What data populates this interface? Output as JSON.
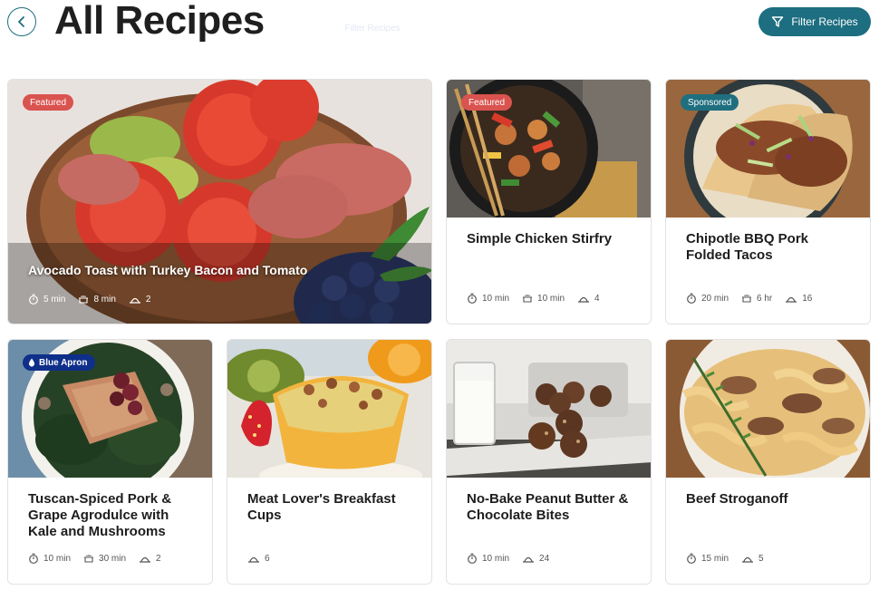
{
  "header": {
    "title": "All Recipes",
    "filter_label": "Filter Recipes",
    "ghost_text": "Filter Recipes"
  },
  "colors": {
    "accent": "#1c6e80",
    "featured": "#d9534f",
    "sponsored": "#1f6f7f",
    "blue_apron": "#0e2f8a"
  },
  "recipes": [
    {
      "title": "Avocado Toast with Turkey Bacon and Tomato",
      "badge": "Featured",
      "time": "5 min",
      "cook": "8 min",
      "servings": "2"
    },
    {
      "title": "Simple Chicken Stirfry",
      "badge": "Featured",
      "time": "10 min",
      "cook": "10 min",
      "servings": "4"
    },
    {
      "title": "Chipotle BBQ Pork Folded Tacos",
      "badge": "Sponsored",
      "time": "20 min",
      "cook": "6 hr",
      "servings": "16"
    },
    {
      "title": "Tuscan-Spiced Pork & Grape Agrodulce with Kale and Mushrooms",
      "badge": "Blue Apron",
      "time": "10 min",
      "cook": "30 min",
      "servings": "2"
    },
    {
      "title": "Meat Lover's Breakfast Cups",
      "servings": "6"
    },
    {
      "title": "No-Bake Peanut Butter & Chocolate Bites",
      "time": "10 min",
      "servings": "24"
    },
    {
      "title": "Beef Stroganoff",
      "time": "15 min",
      "servings": "5"
    }
  ]
}
